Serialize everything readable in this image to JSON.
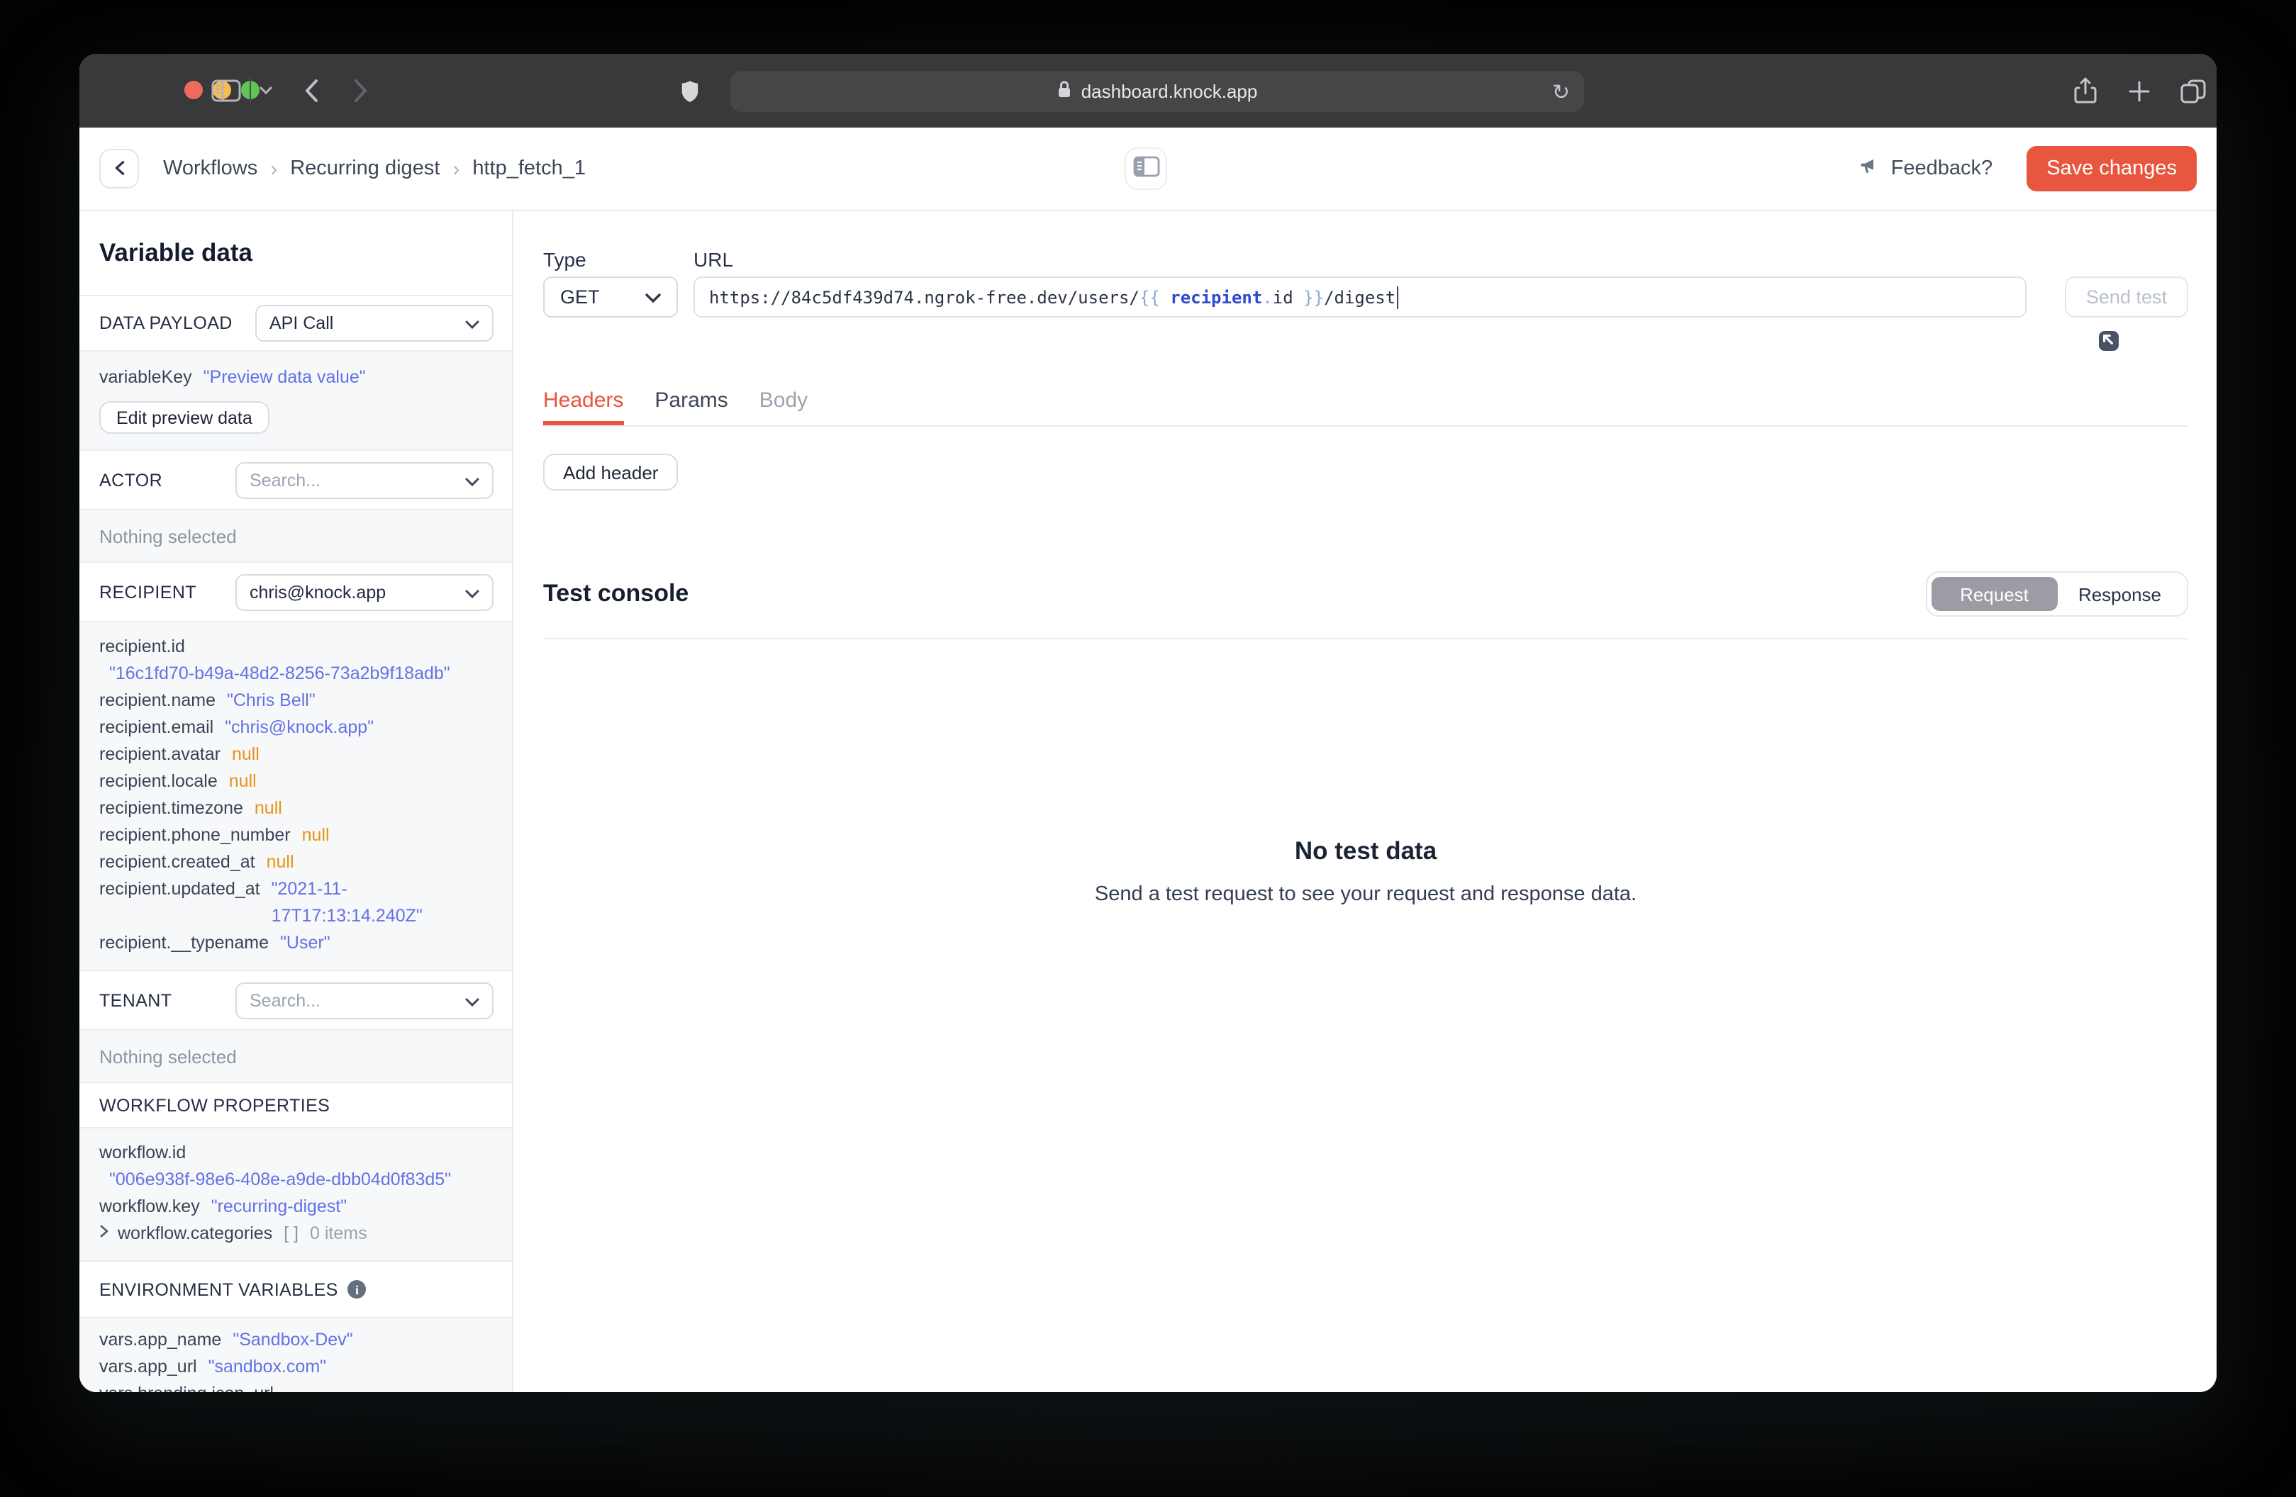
{
  "colors": {
    "accent_red": "#E8563F",
    "string_blue": "#6272E4",
    "null_orange": "#E79312",
    "active_tab_red": "#E8543C",
    "toggle_gray": "#9B9CA4"
  },
  "browser": {
    "url": "dashboard.knock.app",
    "reload_icon": "↻"
  },
  "header": {
    "breadcrumb": [
      "Workflows",
      "Recurring digest",
      "http_fetch_1"
    ],
    "breadcrumb_separator": "›",
    "feedback_label": "Feedback?",
    "save_label": "Save changes"
  },
  "sidebar": {
    "title": "Variable data",
    "data_payload": {
      "label": "DATA PAYLOAD",
      "value": "API Call"
    },
    "preview": {
      "key": "variableKey",
      "value": "\"Preview data value\"",
      "edit_button": "Edit preview data"
    },
    "actor": {
      "label": "ACTOR",
      "placeholder": "Search...",
      "empty": "Nothing selected"
    },
    "recipient": {
      "label": "RECIPIENT",
      "value": "chris@knock.app",
      "fields": [
        {
          "key": "recipient.id",
          "value": "\"16c1fd70-b49a-48d2-8256-73a2b9f18adb\"",
          "type": "string",
          "wrap": true
        },
        {
          "key": "recipient.name",
          "value": "\"Chris Bell\"",
          "type": "string"
        },
        {
          "key": "recipient.email",
          "value": "\"chris@knock.app\"",
          "type": "string"
        },
        {
          "key": "recipient.avatar",
          "value": "null",
          "type": "null"
        },
        {
          "key": "recipient.locale",
          "value": "null",
          "type": "null"
        },
        {
          "key": "recipient.timezone",
          "value": "null",
          "type": "null"
        },
        {
          "key": "recipient.phone_number",
          "value": "null",
          "type": "null"
        },
        {
          "key": "recipient.created_at",
          "value": "null",
          "type": "null"
        },
        {
          "key": "recipient.updated_at",
          "value": "\"2021-11-17T17:13:14.240Z\"",
          "type": "string"
        },
        {
          "key": "recipient.__typename",
          "value": "\"User\"",
          "type": "string"
        }
      ]
    },
    "tenant": {
      "label": "TENANT",
      "placeholder": "Search...",
      "empty": "Nothing selected"
    },
    "workflow": {
      "label": "WORKFLOW PROPERTIES",
      "fields": [
        {
          "key": "workflow.id",
          "value": "\"006e938f-98e6-408e-a9de-dbb04d0f83d5\"",
          "type": "string",
          "wrap": true
        },
        {
          "key": "workflow.key",
          "value": "\"recurring-digest\"",
          "type": "string"
        },
        {
          "key": "workflow.categories",
          "value": "[ ]",
          "type": "array",
          "suffix": "0 items",
          "expandable": true
        }
      ]
    },
    "env": {
      "label": "ENVIRONMENT VARIABLES",
      "fields": [
        {
          "key": "vars.app_name",
          "value": "\"Sandbox-Dev\"",
          "type": "string"
        },
        {
          "key": "vars.app_url",
          "value": "\"sandbox.com\"",
          "type": "string"
        },
        {
          "key": "vars.branding.icon_url"
        }
      ]
    }
  },
  "request": {
    "type_label": "Type",
    "method": "GET",
    "url_label": "URL",
    "url_segments": [
      {
        "text": "https://84c5df439d74.ngrok-free.dev/users/",
        "style": "plain"
      },
      {
        "text": "{{ ",
        "style": "brace"
      },
      {
        "text": "recipient",
        "style": "var"
      },
      {
        "text": ".",
        "style": "dot"
      },
      {
        "text": "id",
        "style": "plain"
      },
      {
        "text": " }}",
        "style": "brace"
      },
      {
        "text": "/digest",
        "style": "plain"
      }
    ],
    "send_test_label": "Send test",
    "tabs": [
      "Headers",
      "Params",
      "Body"
    ],
    "active_tab": "Headers",
    "add_header_label": "Add header"
  },
  "console": {
    "title": "Test console",
    "toggle": [
      "Request",
      "Response"
    ],
    "active_toggle": "Request",
    "empty_title": "No test data",
    "empty_subtitle": "Send a test request to see your request and response data."
  }
}
